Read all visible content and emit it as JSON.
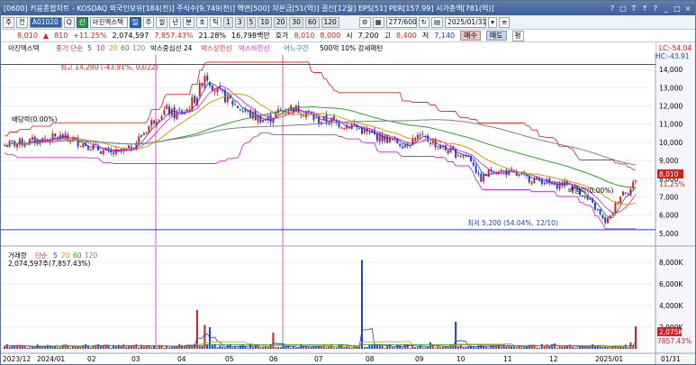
{
  "window": {
    "title": "[0600] 키움종합차트 - KOSDAQ 외국인보유[184(천)] 주식수[9,749(천)] 액면[500] 자본금[51(억)] 결산[12월] EPS[51] PER[157.99] 시가총액[781(억)]",
    "controls": [
      "?",
      "□",
      "T",
      "↑",
      "?",
      "_",
      "□",
      "×"
    ]
  },
  "toolbar": {
    "btn_ju": "주",
    "btn_jeon": "전",
    "code": "A01020",
    "btn_search": "Q",
    "btn_sin": "신",
    "name": "아진엑스텍",
    "periods": [
      "일",
      "주",
      "월",
      "년",
      "분",
      "초",
      "틱"
    ],
    "intervals": [
      "1",
      "3",
      "5",
      "10",
      "20",
      "30",
      "60",
      "120"
    ],
    "count": "277/600",
    "date": "2025/01/31"
  },
  "quote": {
    "price": "8,010",
    "arrow": "▲",
    "change": "810",
    "change_pct": "+11.25%",
    "volume": "2,074,597",
    "vol_pct": "7,857.43%",
    "turnover": "21.28%",
    "amount": "16,798백만",
    "bid_label": "호가",
    "bid": "8,010",
    "ask": "8,000",
    "open_label": "시",
    "open": "7,200",
    "high_label": "고",
    "high": "8,400",
    "low_label": "저",
    "low": "7,140",
    "buy": "매수",
    "sell": "매도",
    "eval": "평"
  },
  "price_panel": {
    "name": "아진엑스텍",
    "ma_title": "종가 단순",
    "ma_periods": [
      "5",
      "10",
      "20",
      "60",
      "120"
    ],
    "bb_title": "박스중심선 24",
    "bb_upper": "박스상한선",
    "bb_lower": "박스하한선",
    "zone": "어느구간",
    "note": "500억 10% 강세패턴",
    "lc": "LC:-54.04",
    "hc": "HC:-43.91",
    "max_label": "최고 14,280 (-43.91%, 03/22)",
    "min_label": "최저 5,200 (54.04%, 12/10)",
    "div_label_left": "배당락(0.00%)",
    "div_label_right": "배당락(0.00%)",
    "last_price": "8,010",
    "last_pct": "11.25%"
  },
  "volume_panel": {
    "title": "거래량",
    "ma_title": "단순",
    "ma_periods": [
      "5",
      "20",
      "60",
      "120"
    ],
    "value": "2,074,597주(7,857.43%)",
    "last_volume": "2,075K",
    "last_pct": "7857.43%"
  },
  "chart_data": {
    "type": "candlestick+volume",
    "price_axis": [
      "14,000",
      "13,000",
      "12,000",
      "11,000",
      "10,000",
      "9,000",
      "8,000",
      "7,000",
      "6,000",
      "5,000"
    ],
    "volume_axis": [
      "8,000K",
      "6,000K",
      "4,000K",
      "2,000K"
    ],
    "x_labels": [
      "2023/12",
      "2024/01",
      "02",
      "03",
      "04",
      "05",
      "06",
      "07",
      "08",
      "09",
      "10",
      "11",
      "12",
      "2025/01",
      "01/31"
    ],
    "ylim": [
      4500,
      14800
    ],
    "vol_max": 9000,
    "close_path": [
      [
        0,
        9850
      ],
      [
        4,
        10050
      ],
      [
        9,
        10300
      ],
      [
        13,
        9900
      ],
      [
        17,
        9350
      ],
      [
        20,
        9600
      ],
      [
        22,
        10400
      ],
      [
        24,
        11300
      ],
      [
        26,
        11800
      ],
      [
        27,
        11500
      ],
      [
        29,
        11700
      ],
      [
        31,
        12700
      ],
      [
        32,
        13800
      ],
      [
        33,
        13300
      ],
      [
        34,
        12800
      ],
      [
        36,
        12300
      ],
      [
        38,
        11800
      ],
      [
        40,
        11400
      ],
      [
        42,
        11200
      ],
      [
        44,
        11700
      ],
      [
        46,
        11900
      ],
      [
        48,
        11700
      ],
      [
        50,
        11200
      ],
      [
        52,
        11200
      ],
      [
        54,
        11000
      ],
      [
        56,
        10900
      ],
      [
        58,
        10500
      ],
      [
        60,
        10300
      ],
      [
        62,
        10100
      ],
      [
        64,
        9900
      ],
      [
        66,
        10300
      ],
      [
        68,
        10100
      ],
      [
        70,
        9700
      ],
      [
        72,
        9400
      ],
      [
        74,
        9300
      ],
      [
        75,
        8900
      ],
      [
        76,
        7900
      ],
      [
        77,
        8200
      ],
      [
        78,
        8500
      ],
      [
        80,
        8400
      ],
      [
        82,
        8200
      ],
      [
        84,
        8000
      ],
      [
        86,
        7900
      ],
      [
        88,
        7600
      ],
      [
        90,
        7800
      ],
      [
        92,
        7300
      ],
      [
        94,
        6600
      ],
      [
        95,
        6200
      ],
      [
        96,
        5600
      ],
      [
        97,
        5900
      ],
      [
        98,
        6800
      ],
      [
        99,
        7300
      ],
      [
        100,
        7300
      ],
      [
        101,
        8010
      ]
    ],
    "volume_spikes": [
      [
        31,
        3600
      ],
      [
        32,
        2200
      ],
      [
        33,
        2000
      ],
      [
        43,
        1500
      ],
      [
        57,
        8200
      ],
      [
        68,
        600
      ],
      [
        72,
        2500
      ],
      [
        88,
        500
      ],
      [
        100,
        600
      ],
      [
        101,
        2075
      ]
    ]
  },
  "colors": {
    "up": "#d21f1f",
    "down": "#1f3fd0",
    "ma5": "#1f3fd0",
    "ma10": "#ff00cc",
    "ma20": "#c8a000",
    "ma60": "#2f9f2f",
    "ma120": "#808080",
    "box_upper": "#e03030",
    "box_lower": "#d030d0",
    "accent": "#3266b0"
  }
}
